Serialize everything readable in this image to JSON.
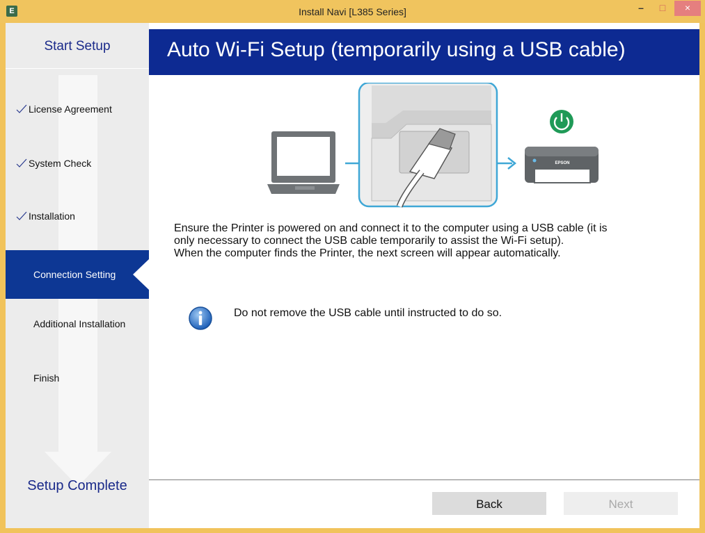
{
  "window": {
    "title": "Install Navi [L385 Series]",
    "icon_letter": "E",
    "controls": {
      "minimize": "–",
      "maximize": "□",
      "close": "×"
    }
  },
  "sidebar": {
    "start_label": "Start Setup",
    "complete_label": "Setup Complete",
    "steps": [
      {
        "label": "License Agreement",
        "done": true
      },
      {
        "label": "System Check",
        "done": true
      },
      {
        "label": "Installation",
        "done": true
      },
      {
        "label": "Connection Setting",
        "active": true
      },
      {
        "label": "Additional Installation"
      },
      {
        "label": "Finish"
      }
    ]
  },
  "main": {
    "title": "Auto Wi-Fi Setup (temporarily using a USB cable)",
    "printer_brand": "EPSON",
    "instructions": [
      "Ensure the Printer is powered on and connect it to the computer using a USB cable (it is",
      "only necessary to connect the USB cable temporarily to assist the Wi-Fi setup).",
      "When the computer finds the Printer, the next screen will appear automatically."
    ],
    "info_note": "Do not remove the USB cable until instructed to do so."
  },
  "buttons": {
    "back": "Back",
    "next": "Next"
  },
  "colors": {
    "frame": "#f1c35b",
    "header_bg": "#0d2a92",
    "active_step_bg": "#0d3794",
    "sidebar_bg": "#ececec",
    "accent_teal": "#3fa7d6",
    "power_green": "#1f9a57"
  },
  "icons": [
    "app-icon",
    "check-icon",
    "info-icon",
    "power-icon",
    "laptop-icon",
    "printer-icon",
    "usb-icon"
  ]
}
